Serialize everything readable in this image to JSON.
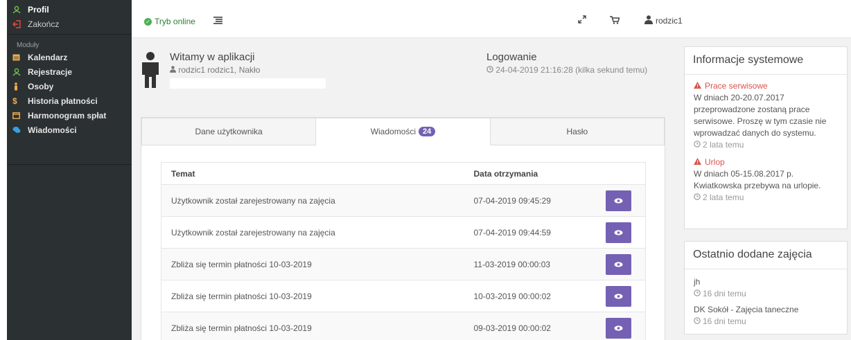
{
  "sidebar": {
    "items_top": [
      {
        "label": "Profil",
        "icon": "user-icon"
      },
      {
        "label": "Zakończ",
        "icon": "logout-icon"
      }
    ],
    "modules_caption": "Moduły",
    "modules": [
      {
        "label": "Kalendarz",
        "icon": "calendar-icon"
      },
      {
        "label": "Rejestracje",
        "icon": "user-icon"
      },
      {
        "label": "Osoby",
        "icon": "person-icon"
      },
      {
        "label": "Historia płatności",
        "icon": "dollar-icon"
      },
      {
        "label": "Harmonogram spłat",
        "icon": "calendar-icon"
      },
      {
        "label": "Wiadomości",
        "icon": "comments-icon"
      }
    ]
  },
  "topbar": {
    "status": "Tryb online",
    "username": "rodzic1"
  },
  "welcome": {
    "title": "Witamy w aplikacji",
    "subtitle": "rodzic1 rodzic1, Nakło",
    "login_title": "Logowanie",
    "login_time": "24-04-2019 21:16:28 (kilka sekund temu)"
  },
  "tabs": [
    {
      "label": "Dane użytkownika"
    },
    {
      "label": "Wiadomości",
      "badge": "24"
    },
    {
      "label": "Hasło"
    }
  ],
  "messages": {
    "headers": [
      "Temat",
      "Data otrzymania"
    ],
    "rows": [
      {
        "subject": "Użytkownik został zarejestrowany na zajęcia",
        "date": "07-04-2019 09:45:29"
      },
      {
        "subject": "Użytkownik został zarejestrowany na zajęcia",
        "date": "07-04-2019 09:44:59"
      },
      {
        "subject": "Zbliża się termin płatności 10-03-2019",
        "date": "11-03-2019 00:00:03"
      },
      {
        "subject": "Zbliża się termin płatności 10-03-2019",
        "date": "10-03-2019 00:00:02"
      },
      {
        "subject": "Zbliża się termin płatności 10-03-2019",
        "date": "09-03-2019 00:00:02"
      }
    ]
  },
  "sysinfo": {
    "title": "Informacje systemowe",
    "notices": [
      {
        "title": "Prace serwisowe",
        "text": "W dniach 20-20.07.2017 przeprowadzone zostaną prace serwisowe. Proszę w tym czasie nie wprowadzać danych do systemu.",
        "ago": "2 lata temu"
      },
      {
        "title": "Urlop",
        "text": "W dniach 05-15.08.2017 p. Kwiatkowska przebywa na urlopie.",
        "ago": "2 lata temu"
      }
    ]
  },
  "recent": {
    "title": "Ostatnio dodane zajęcia",
    "items": [
      {
        "name": "jh",
        "ago": "16 dni temu"
      },
      {
        "name": "DK Sokół - Zajęcia taneczne",
        "ago": "16 dni temu"
      }
    ]
  },
  "colors": {
    "accent": "#7461b3",
    "sidebar": "#2b3033",
    "online": "#4caf50",
    "warn": "#d9534f",
    "icon_green": "#6cc04a",
    "icon_yellow": "#f0ad4e",
    "icon_blue": "#3a9fd6"
  }
}
